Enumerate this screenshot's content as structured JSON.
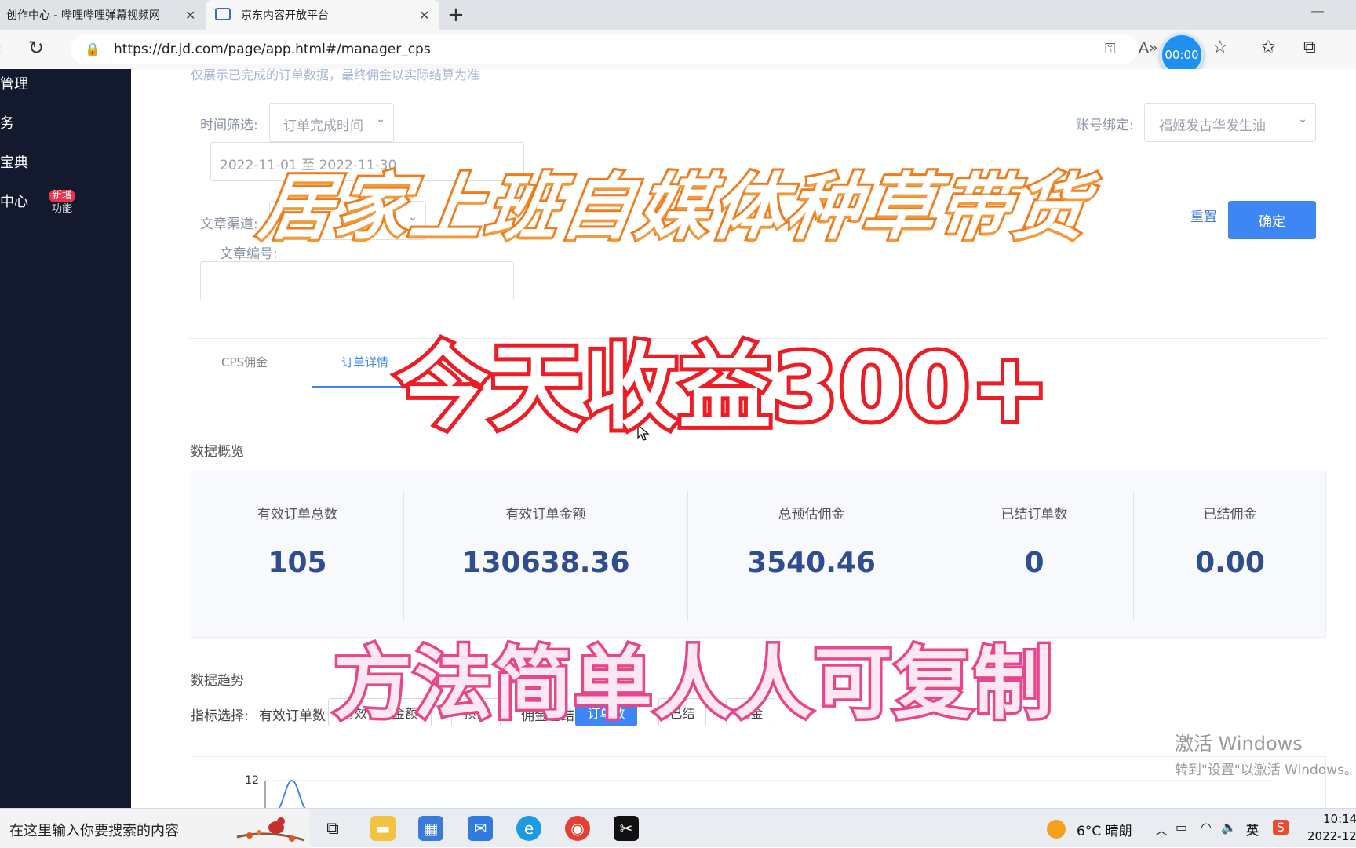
{
  "browser": {
    "tabs": [
      {
        "label": "创作中心 - 哔哩哔哩弹幕视频网"
      },
      {
        "label": "京东内容开放平台"
      }
    ],
    "url": "https://dr.jd.com/page/app.html#/manager_cps",
    "timer": "00:00"
  },
  "sidebar": {
    "items": [
      {
        "label": "管理"
      },
      {
        "label": "务"
      },
      {
        "label": "宝典"
      },
      {
        "label": "中心"
      }
    ],
    "badge_new": "新增",
    "badge_feature": "功能"
  },
  "filters": {
    "notice": "仅展示已完成的订单数据，最终佣金以实际结算为准",
    "time_label": "时间筛选:",
    "time_value": "订单完成时间",
    "date_range": "2022-11-01 至 2022-11-30",
    "account_label": "账号绑定:",
    "account_value": "福姬发古华发生油",
    "channel_label": "文章渠道:",
    "article_id_label": "文章编号:",
    "reset": "重置",
    "confirm": "确定"
  },
  "page_tabs": [
    {
      "label": "CPS佣金"
    },
    {
      "label": "订单详情"
    }
  ],
  "overview": {
    "title": "数据概览",
    "stats": [
      {
        "label": "有效订单总数",
        "value": "105"
      },
      {
        "label": "有效订单金额",
        "value": "130638.36"
      },
      {
        "label": "总预估佣金",
        "value": "3540.46"
      },
      {
        "label": "已结订单数",
        "value": "0"
      },
      {
        "label": "已结佣金",
        "value": "0.00"
      }
    ]
  },
  "trend": {
    "title": "数据趋势",
    "metric_label": "指标选择:",
    "metrics": [
      "有效订单数",
      "有效订单金额",
      "预估",
      "佣金已结",
      "订单数",
      "已结",
      "佣金"
    ],
    "y_tick": "12"
  },
  "watermark": {
    "line1": "激活 Windows",
    "line2": "转到\"设置\"以激活 Windows。"
  },
  "captions": {
    "top": "居家上班自媒体种草带货",
    "middle": "今天收益300+",
    "bottom": "方法简单人人可复制"
  },
  "taskbar": {
    "search_placeholder": "在这里输入你要搜索的内容",
    "weather": "6°C 晴朗",
    "ime": "英",
    "time": "10:14",
    "date": "2022-12"
  }
}
